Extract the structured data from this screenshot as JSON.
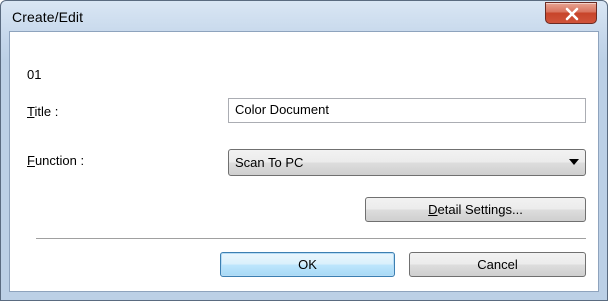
{
  "window": {
    "title": "Create/Edit",
    "close_icon": "close-x-icon"
  },
  "form": {
    "record_number": "01",
    "title_label_accel": "T",
    "title_label_rest": "itle :",
    "title_value": "Color Document",
    "function_label_accel": "F",
    "function_label_rest": "unction :",
    "function_value": "Scan To PC",
    "dropdown_icon": "chevron-down-icon"
  },
  "buttons": {
    "detail_accel": "D",
    "detail_rest": "etail Settings...",
    "ok_label": "OK",
    "cancel_label": "Cancel"
  },
  "colors": {
    "titlebar": "#c4d6ea",
    "close_button": "#c7442a",
    "default_button_border": "#3c7fb1"
  }
}
